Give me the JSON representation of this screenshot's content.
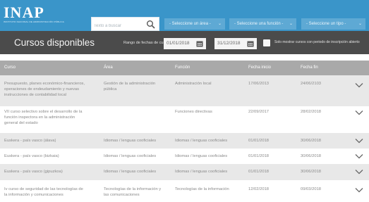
{
  "header": {
    "logo_text": "INAP",
    "logo_subtext": "INSTITUTO NACIONAL DE ADMINISTRACIÓN PÚBLICA",
    "search_placeholder": "Texto a buscar",
    "filters": [
      "- Seleccione un área -",
      "- Seleccione una función -",
      "- Seleccione un tipo -"
    ],
    "colors": {
      "topbar": "#3a95c9",
      "dropdown": "#5ea9d4"
    }
  },
  "titlebar": {
    "title": "Cursos disponibles",
    "date_range_label": "Rango de fechas de cursos",
    "date_from": "01/01/2018",
    "date_to": "31/12/2018",
    "checkbox_label": "Solo mostrar cursos con periodo de inscripción abierto",
    "checkbox_checked": false
  },
  "table": {
    "headers": [
      "Curso",
      "Área",
      "Función",
      "Fecha inicio",
      "Fecha fin"
    ],
    "rows": [
      {
        "curso": [
          "Presupuesto, planes económico-financieros,",
          "operaciones de endeudamiento y nuevas",
          "instrucciones de contabilidad local"
        ],
        "area": [
          "Gestión de la administración",
          "pública"
        ],
        "funcion": "Administración local",
        "inicio": "17/06/2013",
        "fin": "24/06/2103"
      },
      {
        "curso": [
          "VII curso selectivo sobre el desarrollo de la",
          "función inspectora en la administración",
          "general del estado"
        ],
        "area": [],
        "funcion": "Funciones directivas",
        "inicio": "22/09/2017",
        "fin": "28/02/2018"
      },
      {
        "curso": [
          "Euskera - país vasco (álava)"
        ],
        "area": [
          "Idiomas / lenguas cooficiales"
        ],
        "funcion": "Idiomas / lenguas cooficiales",
        "inicio": "01/01/2018",
        "fin": "30/06/2018"
      },
      {
        "curso": [
          "Euskera - país vasco (bizkaia)"
        ],
        "area": [
          "Idiomas / lenguas cooficiales"
        ],
        "funcion": "Idiomas / lenguas cooficiales",
        "inicio": "01/01/2018",
        "fin": "30/06/2018"
      },
      {
        "curso": [
          "Euskera - país vasco (gipuzkoa)"
        ],
        "area": [
          "Idiomas / lenguas cooficiales"
        ],
        "funcion": "Idiomas / lenguas cooficiales",
        "inicio": "01/01/2018",
        "fin": "30/06/2018"
      },
      {
        "curso": [
          "Iv curso de seguridad de las tecnologías de",
          "la información y comunicaciones"
        ],
        "area": [
          "Tecnologías de la información y",
          "las comunicaciones"
        ],
        "funcion": "Tecnologías de la información",
        "inicio": "12/02/2018",
        "fin": "09/03/2018"
      }
    ]
  }
}
